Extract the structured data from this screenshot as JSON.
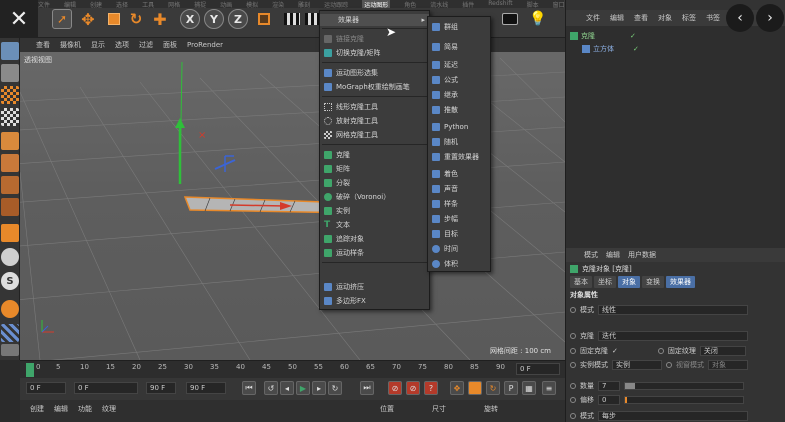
{
  "top_menu_partial": [
    "文件",
    "编辑",
    "创建",
    "选择",
    "工具",
    "网格",
    "捕捉",
    "动画",
    "模拟",
    "渲染",
    "雕刻",
    "运动跟踪",
    "运动图形",
    "角色",
    "流水线",
    "插件",
    "Redshift",
    "脚本",
    "窗口",
    "帮助"
  ],
  "viewport_menu": [
    "查看",
    "摄像机",
    "显示",
    "选项",
    "过滤",
    "面板",
    "ProRender"
  ],
  "viewport_label": "透视视图",
  "grid_distance": "网格间距 : 100 cm",
  "mograph_menu": {
    "items": [
      {
        "label": "效果器",
        "kind": "submenu"
      },
      {
        "label": "链接克隆",
        "kind": "disabled"
      },
      {
        "label": "切换克隆/矩阵",
        "kind": "item"
      },
      {
        "label": "运动图形选集",
        "kind": "item"
      },
      {
        "label": "MoGraph权重绘制画笔",
        "kind": "item"
      },
      {
        "label": "线形克隆工具",
        "kind": "item"
      },
      {
        "label": "放射克隆工具",
        "kind": "item"
      },
      {
        "label": "网格克隆工具",
        "kind": "item"
      },
      {
        "label": "克隆",
        "kind": "item"
      },
      {
        "label": "矩阵",
        "kind": "item"
      },
      {
        "label": "分裂",
        "kind": "item"
      },
      {
        "label": "破碎（Voronoi）",
        "kind": "item"
      },
      {
        "label": "实例",
        "kind": "item"
      },
      {
        "label": "文本",
        "kind": "item"
      },
      {
        "label": "追踪对象",
        "kind": "item"
      },
      {
        "label": "运动样条",
        "kind": "item"
      },
      {
        "label": "运动挤压",
        "kind": "item"
      },
      {
        "label": "多边形FX",
        "kind": "item"
      }
    ]
  },
  "effector_submenu": [
    "群组",
    "简易",
    "延迟",
    "公式",
    "继承",
    "推散",
    "Python",
    "随机",
    "重置效果器",
    "着色",
    "声音",
    "样条",
    "步幅",
    "目标",
    "时间",
    "体积"
  ],
  "object_panel": {
    "menu": [
      "文件",
      "编辑",
      "查看",
      "对象",
      "标签",
      "书签"
    ],
    "objects": [
      "克隆",
      "立方体"
    ]
  },
  "attr_panel": {
    "menu": [
      "模式",
      "编辑",
      "用户数据"
    ],
    "title": "克隆对象 [克隆]",
    "tabs": [
      "基本",
      "坐标",
      "对象",
      "变换",
      "效果器"
    ],
    "active_tab": "对象",
    "section": "对象属性",
    "mode_label": "模式",
    "mode_value": "线性",
    "clone_label": "克隆",
    "clone_value": "迭代",
    "fixed_clone_label": "固定克隆",
    "fixed_clone_check": "✓",
    "fixed_texture_label": "固定纹理",
    "fixed_texture_value": "关闭",
    "instance_mode_label": "实例模式",
    "instance_mode_value": "实例",
    "viewport_mode_label": "视窗模式",
    "viewport_mode_value": "对象",
    "count_label": "数量",
    "count_value": "7",
    "offset_label": "偏移",
    "offset_value": "0",
    "mode2_label": "模式",
    "mode2_value": "每步"
  },
  "timeline_ticks": [
    "0",
    "5",
    "10",
    "15",
    "20",
    "25",
    "30",
    "35",
    "40",
    "45",
    "50",
    "55",
    "60",
    "65",
    "70",
    "75",
    "80",
    "85",
    "90"
  ],
  "playbar": {
    "start": "0 F",
    "current": "0 F",
    "end": "90 F",
    "end2": "90 F",
    "frame_field": "0 F"
  },
  "bottom_menu": [
    "创建",
    "编辑",
    "功能",
    "纹理"
  ],
  "coord_heads": [
    "位置",
    "尺寸",
    "旋转"
  ],
  "colors": {
    "accent": "#4a6fa5",
    "orange": "#e8892a",
    "green_axis": "#2fbf3a",
    "red_axis": "#d43b2b",
    "blue_axis": "#3b64d6"
  }
}
